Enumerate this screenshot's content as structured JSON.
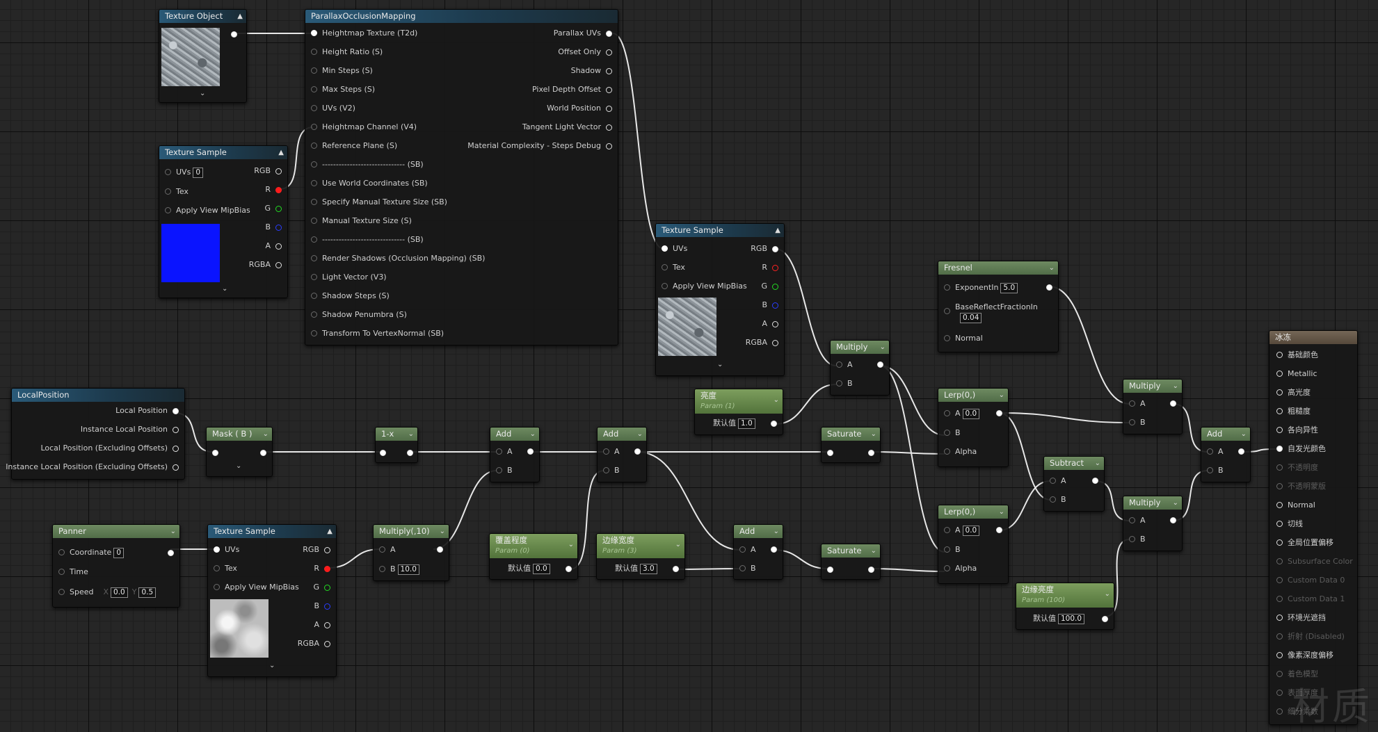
{
  "nodes": {
    "texture_object": {
      "title": "Texture Object"
    },
    "pom": {
      "title": "ParallaxOcclusionMapping",
      "inputs": [
        "Heightmap Texture (T2d)",
        "Height Ratio (S)",
        "Min Steps (S)",
        "Max Steps (S)",
        "UVs (V2)",
        "Heightmap Channel (V4)",
        "Reference Plane (S)",
        "------------------------------ (SB)",
        "Use World Coordinates (SB)",
        "Specify Manual Texture Size (SB)",
        "Manual Texture Size (S)",
        "------------------------------ (SB)",
        "Render Shadows (Occlusion Mapping) (SB)",
        "Light Vector (V3)",
        "Shadow Steps (S)",
        "Shadow Penumbra (S)",
        "Transform To VertexNormal (SB)"
      ],
      "outputs": [
        "Parallax UVs",
        "Offset Only",
        "Shadow",
        "Pixel Depth Offset",
        "World Position",
        "Tangent Light Vector",
        "Material Complexity - Steps Debug"
      ]
    },
    "ts1": {
      "title": "Texture Sample",
      "uvs_label": "UVs",
      "uvs_value": "0",
      "tex": "Tex",
      "mip": "Apply View MipBias",
      "rgb": "RGB",
      "r": "R",
      "g": "G",
      "b": "B",
      "a": "A",
      "rgba": "RGBA"
    },
    "ts2": {
      "title": "Texture Sample",
      "uvs_label": "UVs",
      "tex": "Tex",
      "mip": "Apply View MipBias",
      "rgb": "RGB",
      "r": "R",
      "g": "G",
      "b": "B",
      "a": "A",
      "rgba": "RGBA"
    },
    "ts3": {
      "title": "Texture Sample",
      "uvs_label": "UVs",
      "tex": "Tex",
      "mip": "Apply View MipBias",
      "rgb": "RGB",
      "r": "R",
      "g": "G",
      "b": "B",
      "a": "A",
      "rgba": "RGBA"
    },
    "local_position": {
      "title": "LocalPosition",
      "outputs": [
        "Local Position",
        "Instance Local Position",
        "Local Position (Excluding Offsets)",
        "Instance Local Position (Excluding Offsets)"
      ]
    },
    "mask": {
      "title": "Mask ( B )"
    },
    "one_minus": {
      "title": "1-x"
    },
    "add1": {
      "title": "Add",
      "a": "A",
      "b": "B"
    },
    "add2": {
      "title": "Add",
      "a": "A",
      "b": "B"
    },
    "add3": {
      "title": "Add",
      "a": "A",
      "b": "B"
    },
    "add4": {
      "title": "Add",
      "a": "A",
      "b": "B"
    },
    "multiply1": {
      "title": "Multiply",
      "a": "A",
      "b": "B"
    },
    "multiply2": {
      "title": "Multiply",
      "a": "A",
      "b": "B"
    },
    "multiply3": {
      "title": "Multiply",
      "a": "A",
      "b": "B"
    },
    "multiply10": {
      "title": "Multiply(,10)",
      "a": "A",
      "b": "B",
      "b_value": "10.0"
    },
    "saturate1": {
      "title": "Saturate"
    },
    "saturate2": {
      "title": "Saturate"
    },
    "subtract": {
      "title": "Subtract",
      "a": "A",
      "b": "B"
    },
    "lerp1": {
      "title": "Lerp(0,)",
      "a": "A",
      "a_value": "0.0",
      "b": "B",
      "alpha": "Alpha"
    },
    "lerp2": {
      "title": "Lerp(0,)",
      "a": "A",
      "a_value": "0.0",
      "b": "B",
      "alpha": "Alpha"
    },
    "fresnel": {
      "title": "Fresnel",
      "exponent_label": "ExponentIn",
      "exponent_value": "5.0",
      "base_label": "BaseReflectFractionIn",
      "base_value": "0.04",
      "normal": "Normal"
    },
    "param_brightness": {
      "title": "亮度",
      "sub": "Param (1)",
      "default_label": "默认值",
      "value": "1.0"
    },
    "param_coverage": {
      "title": "覆盖程度",
      "sub": "Param (0)",
      "default_label": "默认值",
      "value": "0.0"
    },
    "param_edge_width": {
      "title": "边缘宽度",
      "sub": "Param (3)",
      "default_label": "默认值",
      "value": "3.0"
    },
    "param_edge_bright": {
      "title": "边缘亮度",
      "sub": "Param (100)",
      "default_label": "默认值",
      "value": "100.0"
    },
    "panner": {
      "title": "Panner",
      "coordinate": "Coordinate",
      "coordinate_value": "0",
      "time": "Time",
      "speed": "Speed",
      "x_label": "X",
      "x_value": "0.0",
      "y_label": "Y",
      "y_value": "0.5"
    },
    "result": {
      "title": "冰冻",
      "inputs": [
        {
          "label": "基础颜色",
          "active": true
        },
        {
          "label": "Metallic",
          "active": true
        },
        {
          "label": "高光度",
          "active": true
        },
        {
          "label": "粗糙度",
          "active": true
        },
        {
          "label": "各向异性",
          "active": true
        },
        {
          "label": "自发光颜色",
          "active": true
        },
        {
          "label": "不透明度",
          "active": false
        },
        {
          "label": "不透明蒙版",
          "active": false
        },
        {
          "label": "Normal",
          "active": true
        },
        {
          "label": "切线",
          "active": true
        },
        {
          "label": "全局位置偏移",
          "active": true
        },
        {
          "label": "Subsurface Color",
          "active": false
        },
        {
          "label": "Custom Data 0",
          "active": false
        },
        {
          "label": "Custom Data 1",
          "active": false
        },
        {
          "label": "环境光遮挡",
          "active": true
        },
        {
          "label": "折射 (Disabled)",
          "active": false
        },
        {
          "label": "像素深度偏移",
          "active": true
        },
        {
          "label": "着色模型",
          "active": false
        },
        {
          "label": "表面厚度",
          "active": false
        },
        {
          "label": "细分乘数",
          "active": false
        }
      ]
    }
  },
  "watermark": "材质",
  "colors": {
    "canvas": "#262626",
    "wire": "#e8e8e8",
    "header_blue": "#2a5a78",
    "header_gray": "#5d5d5d",
    "header_green": "#6e8a61",
    "param_green": "#7d9e5e",
    "result_header": "#746656"
  }
}
